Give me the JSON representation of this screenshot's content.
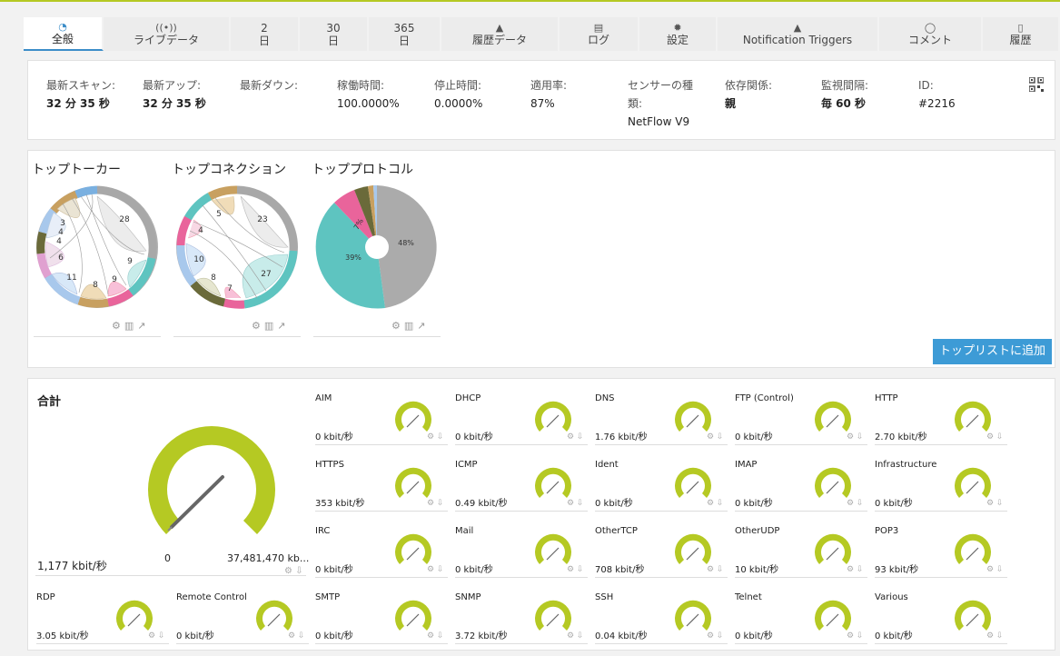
{
  "tabs": [
    {
      "icon": "dashboard-icon",
      "glyph": "◔",
      "label": "全般",
      "active": true
    },
    {
      "icon": "live-data-icon",
      "glyph": "((•))",
      "label": "ライブデータ"
    },
    {
      "icon": "",
      "glyph": "2",
      "label": "日"
    },
    {
      "icon": "",
      "glyph": "30",
      "label": "日"
    },
    {
      "icon": "",
      "glyph": "365",
      "label": "日"
    },
    {
      "icon": "area-chart-icon",
      "glyph": "▲",
      "label": "履歴データ"
    },
    {
      "icon": "log-icon",
      "glyph": "▤",
      "label": "ログ"
    },
    {
      "icon": "gear-icon",
      "glyph": "✹",
      "label": "設定"
    },
    {
      "icon": "bell-icon",
      "glyph": "▲",
      "label": "Notification Triggers"
    },
    {
      "icon": "comment-icon",
      "glyph": "◯",
      "label": "コメント"
    },
    {
      "icon": "history-icon",
      "glyph": "▯",
      "label": "履歴"
    }
  ],
  "info": {
    "last_scan": {
      "label": "最新スキャン:",
      "value": "32 分 35 秒"
    },
    "last_up": {
      "label": "最新アップ:",
      "value": "32 分 35 秒"
    },
    "last_down": {
      "label": "最新ダウン:",
      "value": ""
    },
    "uptime": {
      "label": "稼働時間:",
      "value": "100.0000%"
    },
    "downtime": {
      "label": "停止時間:",
      "value": "0.0000%"
    },
    "coverage": {
      "label": "適用率:",
      "value": "87%"
    },
    "sensor_type": {
      "label1": "センサーの種",
      "label2": "類:",
      "value": "NetFlow V9"
    },
    "dependency": {
      "label": "依存関係:",
      "value": "親"
    },
    "interval": {
      "label": "監視間隔:",
      "value": "毎 60 秒"
    },
    "id": {
      "label": "ID:",
      "value": "#2216"
    }
  },
  "toplists": {
    "talkers": {
      "title": "トップトーカー",
      "labels": [
        "28",
        "9",
        "9",
        "8",
        "11",
        "6",
        "4",
        "4",
        "3"
      ]
    },
    "connections": {
      "title": "トップコネクション",
      "labels": [
        "23",
        "27",
        "7",
        "8",
        "10",
        "4",
        "5"
      ]
    },
    "protocols": {
      "title": "トッププロトコル",
      "labels": [
        "48%",
        "39%",
        "7%"
      ]
    },
    "add_button": "トップリストに追加"
  },
  "colors": {
    "gauge": "#b5c923",
    "accent": "#3d9bd6",
    "teal": "#5ec4c0",
    "gray": "#b0b0b0",
    "pink": "#e9649b"
  },
  "total": {
    "title": "合計",
    "value": "1,177 kbit/秒",
    "min": "0",
    "max": "37,481,470 kb..."
  },
  "channels": [
    {
      "name": "AIM",
      "value": "0 kbit/秒"
    },
    {
      "name": "DHCP",
      "value": "0 kbit/秒"
    },
    {
      "name": "DNS",
      "value": "1.76 kbit/秒"
    },
    {
      "name": "FTP (Control)",
      "value": "0 kbit/秒"
    },
    {
      "name": "HTTP",
      "value": "2.70 kbit/秒"
    },
    {
      "name": "HTTPS",
      "value": "353 kbit/秒"
    },
    {
      "name": "ICMP",
      "value": "0.49 kbit/秒"
    },
    {
      "name": "Ident",
      "value": "0 kbit/秒"
    },
    {
      "name": "IMAP",
      "value": "0 kbit/秒"
    },
    {
      "name": "Infrastructure",
      "value": "0 kbit/秒"
    },
    {
      "name": "IRC",
      "value": "0 kbit/秒"
    },
    {
      "name": "Mail",
      "value": "0 kbit/秒"
    },
    {
      "name": "OtherTCP",
      "value": "708 kbit/秒"
    },
    {
      "name": "OtherUDP",
      "value": "10 kbit/秒"
    },
    {
      "name": "POP3",
      "value": "93 kbit/秒"
    },
    {
      "name": "RDP",
      "value": "3.05 kbit/秒"
    },
    {
      "name": "Remote Control",
      "value": "0 kbit/秒"
    },
    {
      "name": "SMTP",
      "value": "0 kbit/秒"
    },
    {
      "name": "SNMP",
      "value": "3.72 kbit/秒"
    },
    {
      "name": "SSH",
      "value": "0.04 kbit/秒"
    },
    {
      "name": "Telnet",
      "value": "0 kbit/秒"
    },
    {
      "name": "Various",
      "value": "0 kbit/秒"
    }
  ]
}
